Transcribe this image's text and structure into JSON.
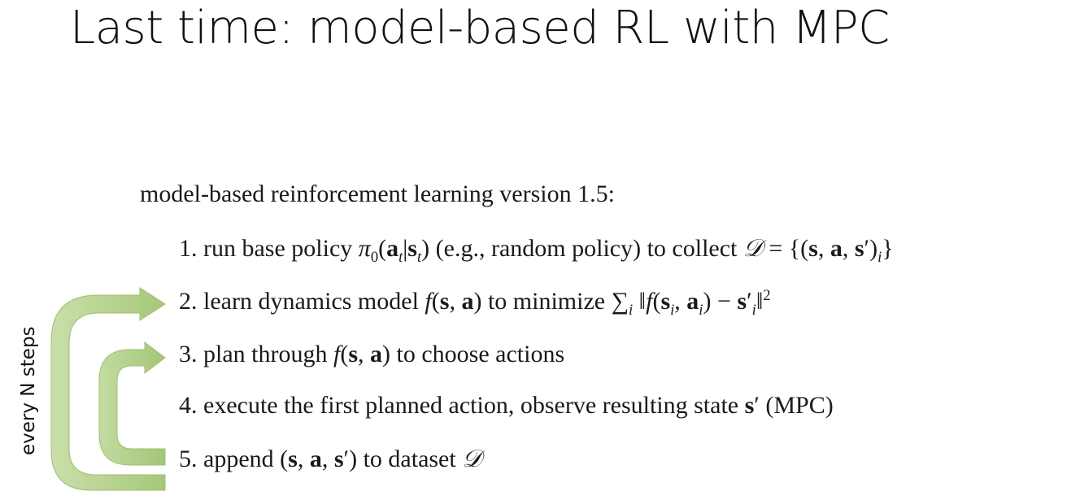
{
  "slide": {
    "title": "Last time: model-based RL with MPC",
    "heading": "model-based reinforcement learning version 1.5:",
    "side_label": "every N steps",
    "arrow_color": "#a9c97a",
    "steps": [
      {
        "num": "1.",
        "text_a": "run base policy ",
        "text_b": " (e.g., random policy) to collect "
      },
      {
        "num": "2.",
        "text_a": "learn dynamics model ",
        "text_b": " to minimize "
      },
      {
        "num": "3.",
        "text_a": "plan through ",
        "text_b": " to choose actions"
      },
      {
        "num": "4.",
        "text_a": "execute the first planned action, observe resulting state ",
        "text_b": " (MPC)"
      },
      {
        "num": "5.",
        "text_a": "append ",
        "text_b": " to dataset "
      }
    ]
  }
}
